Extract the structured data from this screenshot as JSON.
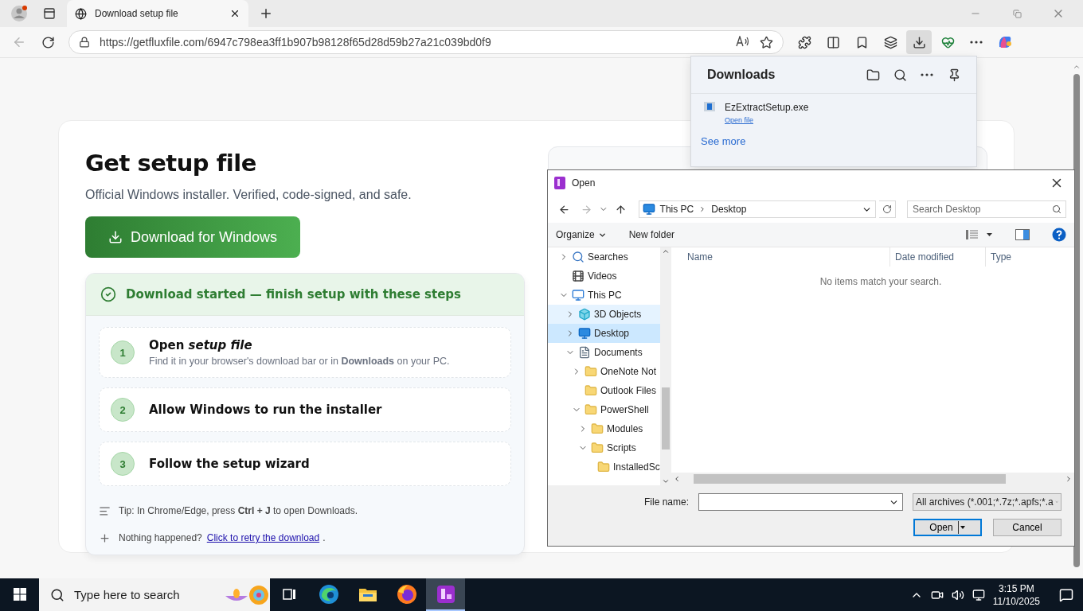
{
  "browser": {
    "tab": {
      "title": "Download setup file",
      "selected": true
    },
    "address": "https://getfluxfile.com/6947c798ea3ff1b907b98128f65d28d59b27a21c039bd0f9",
    "downloads_active": true
  },
  "page": {
    "title": "Get setup file",
    "subtitle": "Official Windows installer. Verified, code-signed, and safe.",
    "download_button": "Download for Windows",
    "status": "Download started — finish setup with these steps",
    "steps": [
      {
        "number": "1",
        "title": "Open *setup file*",
        "description": "Find it in your browser's download bar or in **Downloads** on your PC."
      },
      {
        "number": "2",
        "title": "Allow Windows to run the installer"
      },
      {
        "number": "3",
        "title": "Follow the setup wizard"
      }
    ],
    "tip": "Tip: In Chrome/Edge, press **Ctrl + J** to open Downloads.",
    "retry": {
      "text": "Nothing happened?",
      "link": "Click to retry the download",
      "end": "."
    }
  },
  "downloads_panel": {
    "title": "Downloads",
    "items": [
      {
        "name": "EzExtractSetup.exe",
        "action": "Open file"
      }
    ],
    "see_more": "See more"
  },
  "open_dialog": {
    "title": "Open",
    "breadcrumb": [
      "This PC",
      "Desktop"
    ],
    "search_placeholder": "Search Desktop",
    "commands": [
      {
        "label": "Organize",
        "menu": true
      },
      {
        "label": "New folder",
        "menu": false
      }
    ],
    "tree": [
      {
        "label": "Searches",
        "kind": "search",
        "expanded": false,
        "selected": false,
        "hovered": false
      },
      {
        "label": "Videos",
        "kind": "video",
        "selected": false,
        "hovered": false
      },
      {
        "label": "This PC",
        "kind": "pc",
        "expanded": true,
        "selected": false,
        "hovered": false,
        "children": [
          {
            "label": "3D Objects",
            "kind": "cube",
            "expanded": false,
            "selected": false,
            "hovered": true
          },
          {
            "label": "Desktop",
            "kind": "desktop",
            "expanded": false,
            "selected": true,
            "hovered": false
          },
          {
            "label": "Documents",
            "kind": "document",
            "expanded": true,
            "selected": false,
            "hovered": false,
            "children": [
              {
                "label": "OneNote Not",
                "kind": "folder",
                "expanded": false,
                "selected": false,
                "hovered": false
              },
              {
                "label": "Outlook Files",
                "kind": "folder",
                "selected": false,
                "hovered": false
              },
              {
                "label": "PowerShell",
                "kind": "folder",
                "expanded": true,
                "selected": false,
                "hovered": false,
                "children": [
                  {
                    "label": "Modules",
                    "kind": "folder",
                    "expanded": false,
                    "selected": false,
                    "hovered": false
                  },
                  {
                    "label": "Scripts",
                    "kind": "folder",
                    "expanded": true,
                    "selected": false,
                    "hovered": false,
                    "children": [
                      {
                        "label": "InstalledSc",
                        "kind": "folder",
                        "selected": false,
                        "hovered": false
                      }
                    ]
                  }
                ]
              }
            ]
          }
        ]
      }
    ],
    "columns": [
      "Name",
      "Date modified",
      "Type"
    ],
    "empty_message": "No items match your search.",
    "file_name_label": "File name:",
    "file_type": "All archives (*.001;*.7z;*.apfs;*.a",
    "buttons": [
      {
        "label": "Open",
        "default": true
      },
      {
        "label": "Cancel",
        "default": false
      }
    ]
  },
  "taskbar": {
    "search_placeholder": "Type here to search",
    "apps": [
      {
        "kind": "taskview",
        "active": false
      },
      {
        "kind": "edge",
        "active": false
      },
      {
        "kind": "explorer",
        "active": false
      },
      {
        "kind": "firefox",
        "active": false
      },
      {
        "kind": "archiver",
        "active": true
      }
    ],
    "time": "3:15 PM",
    "date": "11/10/2025"
  }
}
